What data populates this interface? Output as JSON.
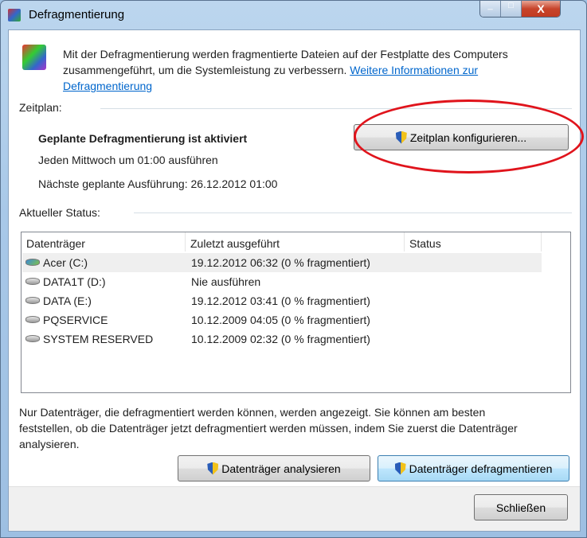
{
  "window": {
    "title": "Defragmentierung"
  },
  "intro": {
    "text": "Mit der Defragmentierung werden fragmentierte Dateien auf der Festplatte des Computers",
    "text2": "zusammengeführt, um die Systemleistung zu verbessern.",
    "link1": "Weitere Informationen zur",
    "link2": "Defragmentierung"
  },
  "schedule": {
    "heading": "Zeitplan:",
    "status": "Geplante Defragmentierung ist aktiviert",
    "frequency": "Jeden Mittwoch um 01:00 ausführen",
    "next": "Nächste geplante Ausführung: 26.12.2012 01:00",
    "configure_button": "Zeitplan konfigurieren..."
  },
  "current": {
    "heading": "Aktueller Status:"
  },
  "table": {
    "columns": [
      "Datenträger",
      "Zuletzt ausgeführt",
      "Status"
    ],
    "rows": [
      {
        "name": "Acer (C:)",
        "last": "19.12.2012 06:32 (0 % fragmentiert)",
        "status": ""
      },
      {
        "name": "DATA1T (D:)",
        "last": "Nie ausführen",
        "status": ""
      },
      {
        "name": "DATA (E:)",
        "last": "19.12.2012 03:41 (0 % fragmentiert)",
        "status": ""
      },
      {
        "name": "PQSERVICE",
        "last": "10.12.2009 04:05 (0 % fragmentiert)",
        "status": ""
      },
      {
        "name": "SYSTEM RESERVED",
        "last": "10.12.2009 02:32 (0 % fragmentiert)",
        "status": ""
      }
    ]
  },
  "note": {
    "l1": "Nur Datenträger, die defragmentiert werden können, werden angezeigt. Sie können am besten",
    "l2": "feststellen, ob die Datenträger jetzt defragmentiert werden müssen, indem Sie zuerst die Datenträger",
    "l3": "analysieren."
  },
  "buttons": {
    "analyze": "Datenträger analysieren",
    "defrag": "Datenträger defragmentieren",
    "close": "Schließen"
  },
  "colors": {
    "annotation": "#e0141c",
    "link": "#0066cc"
  }
}
